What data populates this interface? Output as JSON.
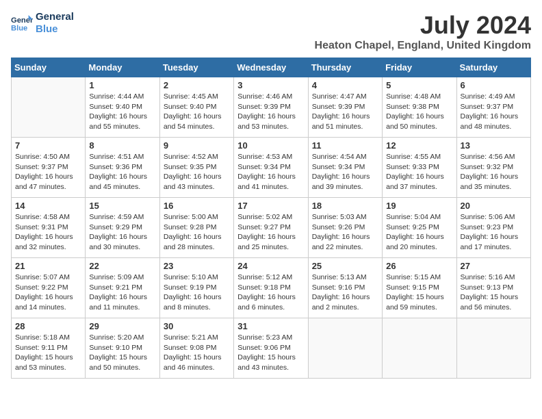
{
  "logo": {
    "line1": "General",
    "line2": "Blue"
  },
  "title": "July 2024",
  "subtitle": "Heaton Chapel, England, United Kingdom",
  "weekdays": [
    "Sunday",
    "Monday",
    "Tuesday",
    "Wednesday",
    "Thursday",
    "Friday",
    "Saturday"
  ],
  "weeks": [
    [
      {
        "day": "",
        "info": ""
      },
      {
        "day": "1",
        "info": "Sunrise: 4:44 AM\nSunset: 9:40 PM\nDaylight: 16 hours\nand 55 minutes."
      },
      {
        "day": "2",
        "info": "Sunrise: 4:45 AM\nSunset: 9:40 PM\nDaylight: 16 hours\nand 54 minutes."
      },
      {
        "day": "3",
        "info": "Sunrise: 4:46 AM\nSunset: 9:39 PM\nDaylight: 16 hours\nand 53 minutes."
      },
      {
        "day": "4",
        "info": "Sunrise: 4:47 AM\nSunset: 9:39 PM\nDaylight: 16 hours\nand 51 minutes."
      },
      {
        "day": "5",
        "info": "Sunrise: 4:48 AM\nSunset: 9:38 PM\nDaylight: 16 hours\nand 50 minutes."
      },
      {
        "day": "6",
        "info": "Sunrise: 4:49 AM\nSunset: 9:37 PM\nDaylight: 16 hours\nand 48 minutes."
      }
    ],
    [
      {
        "day": "7",
        "info": "Sunrise: 4:50 AM\nSunset: 9:37 PM\nDaylight: 16 hours\nand 47 minutes."
      },
      {
        "day": "8",
        "info": "Sunrise: 4:51 AM\nSunset: 9:36 PM\nDaylight: 16 hours\nand 45 minutes."
      },
      {
        "day": "9",
        "info": "Sunrise: 4:52 AM\nSunset: 9:35 PM\nDaylight: 16 hours\nand 43 minutes."
      },
      {
        "day": "10",
        "info": "Sunrise: 4:53 AM\nSunset: 9:34 PM\nDaylight: 16 hours\nand 41 minutes."
      },
      {
        "day": "11",
        "info": "Sunrise: 4:54 AM\nSunset: 9:34 PM\nDaylight: 16 hours\nand 39 minutes."
      },
      {
        "day": "12",
        "info": "Sunrise: 4:55 AM\nSunset: 9:33 PM\nDaylight: 16 hours\nand 37 minutes."
      },
      {
        "day": "13",
        "info": "Sunrise: 4:56 AM\nSunset: 9:32 PM\nDaylight: 16 hours\nand 35 minutes."
      }
    ],
    [
      {
        "day": "14",
        "info": "Sunrise: 4:58 AM\nSunset: 9:31 PM\nDaylight: 16 hours\nand 32 minutes."
      },
      {
        "day": "15",
        "info": "Sunrise: 4:59 AM\nSunset: 9:29 PM\nDaylight: 16 hours\nand 30 minutes."
      },
      {
        "day": "16",
        "info": "Sunrise: 5:00 AM\nSunset: 9:28 PM\nDaylight: 16 hours\nand 28 minutes."
      },
      {
        "day": "17",
        "info": "Sunrise: 5:02 AM\nSunset: 9:27 PM\nDaylight: 16 hours\nand 25 minutes."
      },
      {
        "day": "18",
        "info": "Sunrise: 5:03 AM\nSunset: 9:26 PM\nDaylight: 16 hours\nand 22 minutes."
      },
      {
        "day": "19",
        "info": "Sunrise: 5:04 AM\nSunset: 9:25 PM\nDaylight: 16 hours\nand 20 minutes."
      },
      {
        "day": "20",
        "info": "Sunrise: 5:06 AM\nSunset: 9:23 PM\nDaylight: 16 hours\nand 17 minutes."
      }
    ],
    [
      {
        "day": "21",
        "info": "Sunrise: 5:07 AM\nSunset: 9:22 PM\nDaylight: 16 hours\nand 14 minutes."
      },
      {
        "day": "22",
        "info": "Sunrise: 5:09 AM\nSunset: 9:21 PM\nDaylight: 16 hours\nand 11 minutes."
      },
      {
        "day": "23",
        "info": "Sunrise: 5:10 AM\nSunset: 9:19 PM\nDaylight: 16 hours\nand 8 minutes."
      },
      {
        "day": "24",
        "info": "Sunrise: 5:12 AM\nSunset: 9:18 PM\nDaylight: 16 hours\nand 6 minutes."
      },
      {
        "day": "25",
        "info": "Sunrise: 5:13 AM\nSunset: 9:16 PM\nDaylight: 16 hours\nand 2 minutes."
      },
      {
        "day": "26",
        "info": "Sunrise: 5:15 AM\nSunset: 9:15 PM\nDaylight: 15 hours\nand 59 minutes."
      },
      {
        "day": "27",
        "info": "Sunrise: 5:16 AM\nSunset: 9:13 PM\nDaylight: 15 hours\nand 56 minutes."
      }
    ],
    [
      {
        "day": "28",
        "info": "Sunrise: 5:18 AM\nSunset: 9:11 PM\nDaylight: 15 hours\nand 53 minutes."
      },
      {
        "day": "29",
        "info": "Sunrise: 5:20 AM\nSunset: 9:10 PM\nDaylight: 15 hours\nand 50 minutes."
      },
      {
        "day": "30",
        "info": "Sunrise: 5:21 AM\nSunset: 9:08 PM\nDaylight: 15 hours\nand 46 minutes."
      },
      {
        "day": "31",
        "info": "Sunrise: 5:23 AM\nSunset: 9:06 PM\nDaylight: 15 hours\nand 43 minutes."
      },
      {
        "day": "",
        "info": ""
      },
      {
        "day": "",
        "info": ""
      },
      {
        "day": "",
        "info": ""
      }
    ]
  ]
}
